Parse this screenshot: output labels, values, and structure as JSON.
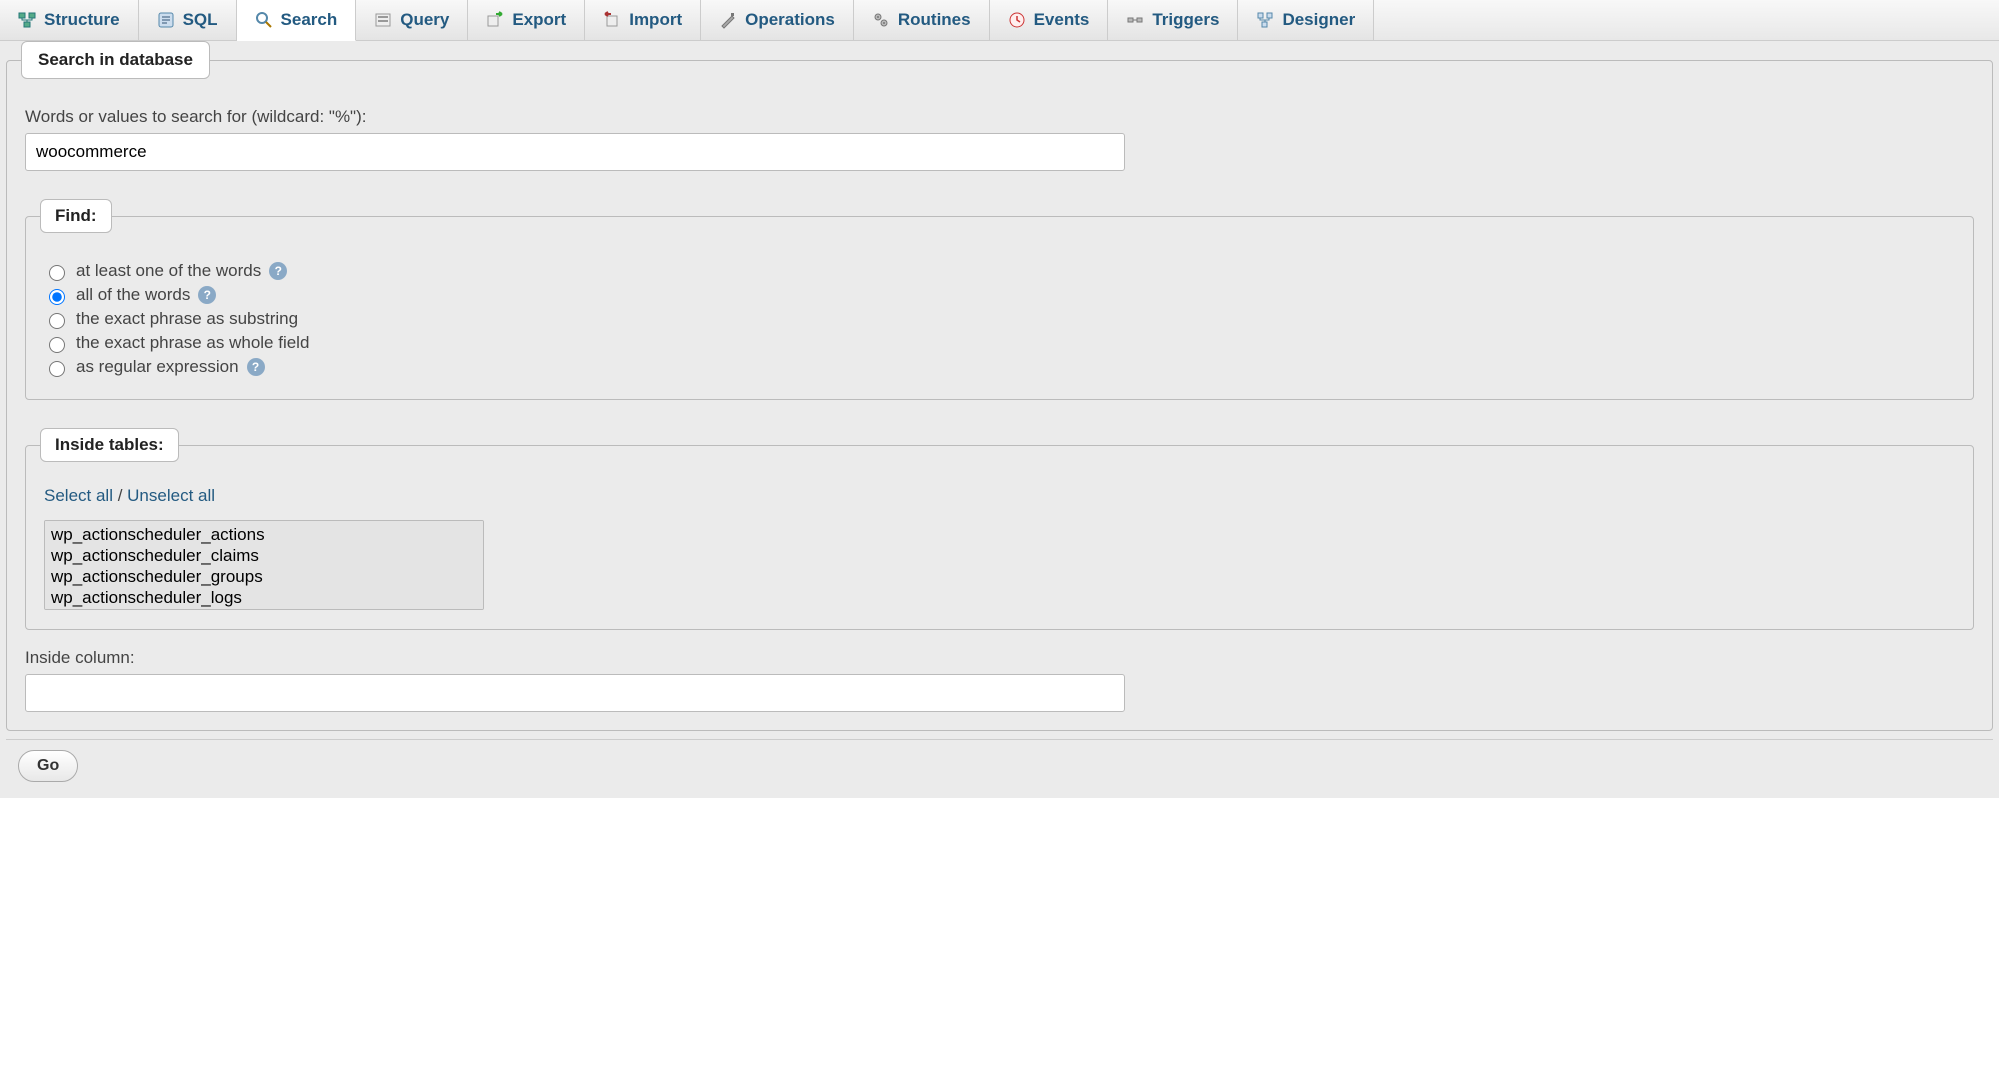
{
  "tabs": [
    {
      "label": "Structure",
      "icon": "structure"
    },
    {
      "label": "SQL",
      "icon": "sql"
    },
    {
      "label": "Search",
      "icon": "search",
      "active": true
    },
    {
      "label": "Query",
      "icon": "query"
    },
    {
      "label": "Export",
      "icon": "export"
    },
    {
      "label": "Import",
      "icon": "import"
    },
    {
      "label": "Operations",
      "icon": "operations"
    },
    {
      "label": "Routines",
      "icon": "routines"
    },
    {
      "label": "Events",
      "icon": "events"
    },
    {
      "label": "Triggers",
      "icon": "triggers"
    },
    {
      "label": "Designer",
      "icon": "designer"
    }
  ],
  "search": {
    "fieldset_label": "Search in database",
    "words_label": "Words or values to search for (wildcard: \"%\"):",
    "words_value": "woocommerce",
    "find_legend": "Find:",
    "find_options": [
      {
        "label": "at least one of the words",
        "help": true,
        "checked": false
      },
      {
        "label": "all of the words",
        "help": true,
        "checked": true
      },
      {
        "label": "the exact phrase as substring",
        "help": false,
        "checked": false
      },
      {
        "label": "the exact phrase as whole field",
        "help": false,
        "checked": false
      },
      {
        "label": "as regular expression",
        "help": true,
        "checked": false
      }
    ],
    "tables_legend": "Inside tables:",
    "select_all": "Select all",
    "unselect_all": "Unselect all",
    "separator": " / ",
    "tables": [
      "wp_actionscheduler_actions",
      "wp_actionscheduler_claims",
      "wp_actionscheduler_groups",
      "wp_actionscheduler_logs"
    ],
    "column_label": "Inside column:",
    "column_value": "",
    "go_label": "Go"
  }
}
